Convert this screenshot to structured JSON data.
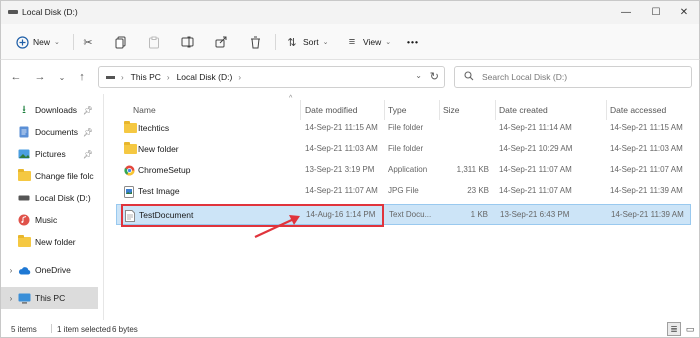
{
  "window": {
    "title": "Local Disk (D:)"
  },
  "toolbar": {
    "new_label": "New",
    "sort_label": "Sort",
    "view_label": "View",
    "more_label": "•••"
  },
  "address": {
    "crumbs": [
      "This PC",
      "Local Disk (D:)"
    ],
    "search_placeholder": "Search Local Disk (D:)"
  },
  "sidebar": {
    "quick_access": [
      {
        "label": "Downloads",
        "icon": "download-icon",
        "pinned": true
      },
      {
        "label": "Documents",
        "icon": "documents-icon",
        "pinned": true
      },
      {
        "label": "Pictures",
        "icon": "pictures-icon",
        "pinned": true
      },
      {
        "label": "Change file folc",
        "icon": "folder-icon",
        "pinned": false
      },
      {
        "label": "Local Disk (D:)",
        "icon": "drive-icon",
        "pinned": false
      },
      {
        "label": "Music",
        "icon": "music-icon",
        "pinned": false
      },
      {
        "label": "New folder",
        "icon": "folder-icon",
        "pinned": false
      }
    ],
    "onedrive": "OneDrive",
    "thispc": "This PC"
  },
  "columns": [
    "Name",
    "Date modified",
    "Type",
    "Size",
    "Date created",
    "Date accessed"
  ],
  "files": [
    {
      "name": "Itechtics",
      "modified": "14-Sep-21 11:15 AM",
      "type": "File folder",
      "size": "",
      "created": "14-Sep-21 11:14 AM",
      "accessed": "14-Sep-21 11:15 AM",
      "icon": "folder-icon"
    },
    {
      "name": "New folder",
      "modified": "14-Sep-21 11:03 AM",
      "type": "File folder",
      "size": "",
      "created": "14-Sep-21 10:29 AM",
      "accessed": "14-Sep-21 11:03 AM",
      "icon": "folder-icon"
    },
    {
      "name": "ChromeSetup",
      "modified": "13-Sep-21 3:19 PM",
      "type": "Application",
      "size": "1,311 KB",
      "created": "14-Sep-21 11:07 AM",
      "accessed": "14-Sep-21 11:07 AM",
      "icon": "application-icon"
    },
    {
      "name": "Test Image",
      "modified": "14-Sep-21 11:07 AM",
      "type": "JPG File",
      "size": "23 KB",
      "created": "14-Sep-21 11:07 AM",
      "accessed": "14-Sep-21 11:39 AM",
      "icon": "image-icon"
    },
    {
      "name": "TestDocument",
      "modified": "14-Aug-16 1:14 PM",
      "type": "Text Docu...",
      "size": "1 KB",
      "created": "13-Sep-21 6:43 PM",
      "accessed": "14-Sep-21 11:39 AM",
      "icon": "text-document-icon"
    }
  ],
  "status": {
    "count": "5 items",
    "selection": "1 item selected",
    "bytes": "6 bytes"
  },
  "colors": {
    "selection": "#cce4f7",
    "annotation": "#e0343c"
  }
}
